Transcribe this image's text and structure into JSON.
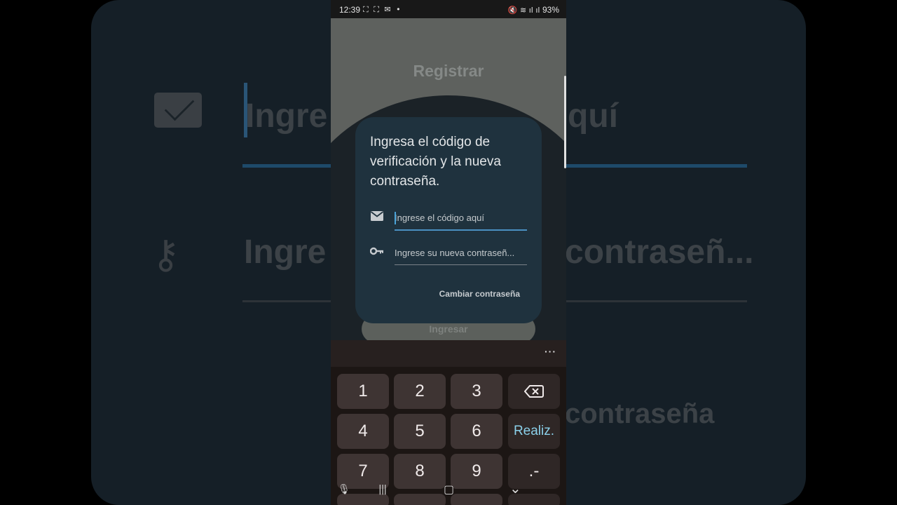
{
  "background": {
    "code_text": "Ingre",
    "code_text_right": "quí",
    "password_text": "Ingre",
    "password_text_right": "contraseñ...",
    "action_text_right": "contraseña"
  },
  "status_bar": {
    "time": "12:39",
    "notification_icons": "⛶ ⛶ ✉ •",
    "system_icons": "🔇 ≋ ıl ıl",
    "battery": "93%"
  },
  "app": {
    "title": "Registrar",
    "login_button": "Ingresar"
  },
  "dialog": {
    "title": "Ingresa el código de verificación y la nueva contraseña.",
    "code_placeholder": "Ingrese el código aquí",
    "password_placeholder": "Ingrese su nueva contraseñ...",
    "action_label": "Cambiar contraseña",
    "accent_color": "#4a90c2"
  },
  "keyboard": {
    "more_label": "···",
    "keys": [
      "1",
      "2",
      "3",
      "⌫",
      "4",
      "5",
      "6",
      "Realiz.",
      "7",
      "8",
      "9",
      ".-"
    ],
    "done_color": "#8bd0ea"
  },
  "nav": {
    "mic": "🎙",
    "recents": "|||",
    "home": "▢",
    "back": "⌄"
  }
}
